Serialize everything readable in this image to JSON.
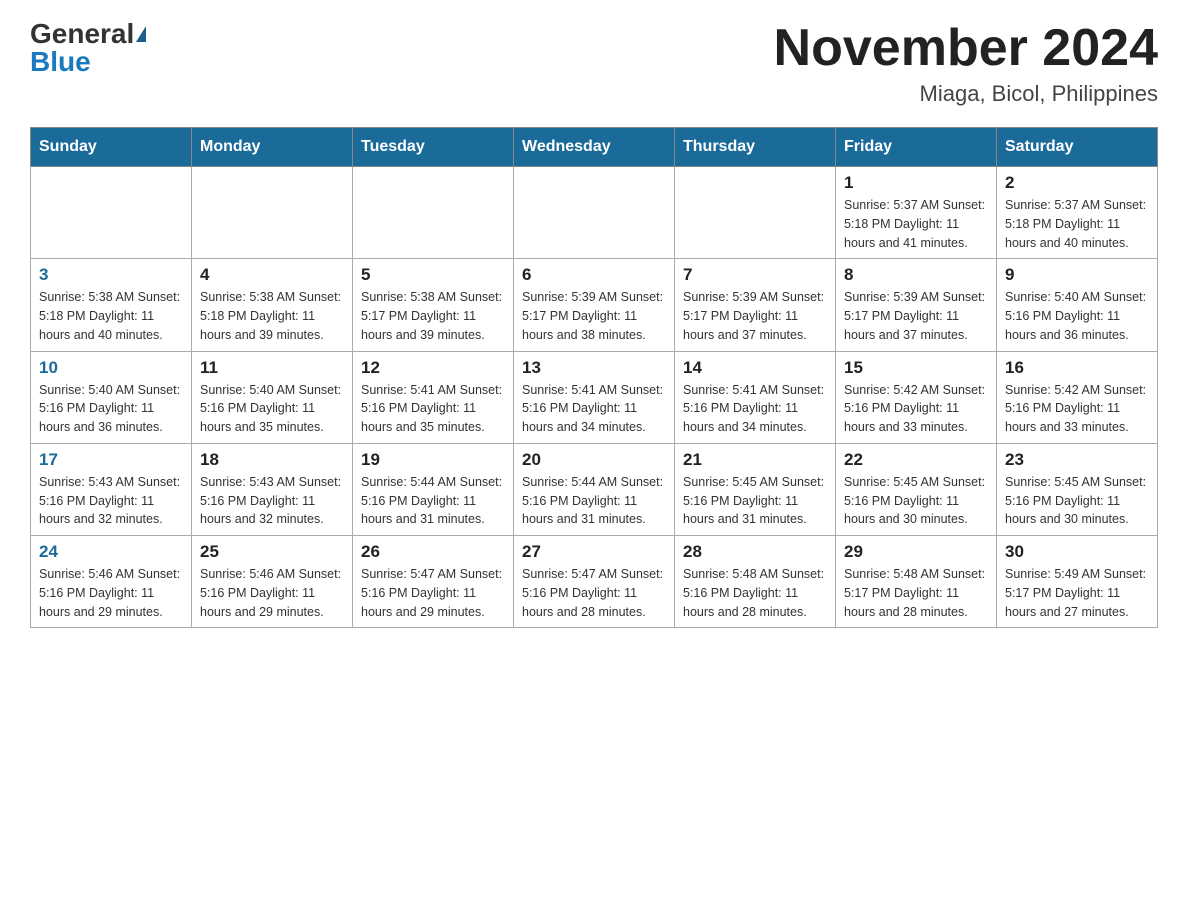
{
  "header": {
    "logo_general": "General",
    "logo_blue": "Blue",
    "month_title": "November 2024",
    "location": "Miaga, Bicol, Philippines"
  },
  "weekdays": [
    "Sunday",
    "Monday",
    "Tuesday",
    "Wednesday",
    "Thursday",
    "Friday",
    "Saturday"
  ],
  "weeks": [
    [
      {
        "day": "",
        "info": ""
      },
      {
        "day": "",
        "info": ""
      },
      {
        "day": "",
        "info": ""
      },
      {
        "day": "",
        "info": ""
      },
      {
        "day": "",
        "info": ""
      },
      {
        "day": "1",
        "info": "Sunrise: 5:37 AM\nSunset: 5:18 PM\nDaylight: 11 hours and 41 minutes."
      },
      {
        "day": "2",
        "info": "Sunrise: 5:37 AM\nSunset: 5:18 PM\nDaylight: 11 hours and 40 minutes."
      }
    ],
    [
      {
        "day": "3",
        "info": "Sunrise: 5:38 AM\nSunset: 5:18 PM\nDaylight: 11 hours and 40 minutes."
      },
      {
        "day": "4",
        "info": "Sunrise: 5:38 AM\nSunset: 5:18 PM\nDaylight: 11 hours and 39 minutes."
      },
      {
        "day": "5",
        "info": "Sunrise: 5:38 AM\nSunset: 5:17 PM\nDaylight: 11 hours and 39 minutes."
      },
      {
        "day": "6",
        "info": "Sunrise: 5:39 AM\nSunset: 5:17 PM\nDaylight: 11 hours and 38 minutes."
      },
      {
        "day": "7",
        "info": "Sunrise: 5:39 AM\nSunset: 5:17 PM\nDaylight: 11 hours and 37 minutes."
      },
      {
        "day": "8",
        "info": "Sunrise: 5:39 AM\nSunset: 5:17 PM\nDaylight: 11 hours and 37 minutes."
      },
      {
        "day": "9",
        "info": "Sunrise: 5:40 AM\nSunset: 5:16 PM\nDaylight: 11 hours and 36 minutes."
      }
    ],
    [
      {
        "day": "10",
        "info": "Sunrise: 5:40 AM\nSunset: 5:16 PM\nDaylight: 11 hours and 36 minutes."
      },
      {
        "day": "11",
        "info": "Sunrise: 5:40 AM\nSunset: 5:16 PM\nDaylight: 11 hours and 35 minutes."
      },
      {
        "day": "12",
        "info": "Sunrise: 5:41 AM\nSunset: 5:16 PM\nDaylight: 11 hours and 35 minutes."
      },
      {
        "day": "13",
        "info": "Sunrise: 5:41 AM\nSunset: 5:16 PM\nDaylight: 11 hours and 34 minutes."
      },
      {
        "day": "14",
        "info": "Sunrise: 5:41 AM\nSunset: 5:16 PM\nDaylight: 11 hours and 34 minutes."
      },
      {
        "day": "15",
        "info": "Sunrise: 5:42 AM\nSunset: 5:16 PM\nDaylight: 11 hours and 33 minutes."
      },
      {
        "day": "16",
        "info": "Sunrise: 5:42 AM\nSunset: 5:16 PM\nDaylight: 11 hours and 33 minutes."
      }
    ],
    [
      {
        "day": "17",
        "info": "Sunrise: 5:43 AM\nSunset: 5:16 PM\nDaylight: 11 hours and 32 minutes."
      },
      {
        "day": "18",
        "info": "Sunrise: 5:43 AM\nSunset: 5:16 PM\nDaylight: 11 hours and 32 minutes."
      },
      {
        "day": "19",
        "info": "Sunrise: 5:44 AM\nSunset: 5:16 PM\nDaylight: 11 hours and 31 minutes."
      },
      {
        "day": "20",
        "info": "Sunrise: 5:44 AM\nSunset: 5:16 PM\nDaylight: 11 hours and 31 minutes."
      },
      {
        "day": "21",
        "info": "Sunrise: 5:45 AM\nSunset: 5:16 PM\nDaylight: 11 hours and 31 minutes."
      },
      {
        "day": "22",
        "info": "Sunrise: 5:45 AM\nSunset: 5:16 PM\nDaylight: 11 hours and 30 minutes."
      },
      {
        "day": "23",
        "info": "Sunrise: 5:45 AM\nSunset: 5:16 PM\nDaylight: 11 hours and 30 minutes."
      }
    ],
    [
      {
        "day": "24",
        "info": "Sunrise: 5:46 AM\nSunset: 5:16 PM\nDaylight: 11 hours and 29 minutes."
      },
      {
        "day": "25",
        "info": "Sunrise: 5:46 AM\nSunset: 5:16 PM\nDaylight: 11 hours and 29 minutes."
      },
      {
        "day": "26",
        "info": "Sunrise: 5:47 AM\nSunset: 5:16 PM\nDaylight: 11 hours and 29 minutes."
      },
      {
        "day": "27",
        "info": "Sunrise: 5:47 AM\nSunset: 5:16 PM\nDaylight: 11 hours and 28 minutes."
      },
      {
        "day": "28",
        "info": "Sunrise: 5:48 AM\nSunset: 5:16 PM\nDaylight: 11 hours and 28 minutes."
      },
      {
        "day": "29",
        "info": "Sunrise: 5:48 AM\nSunset: 5:17 PM\nDaylight: 11 hours and 28 minutes."
      },
      {
        "day": "30",
        "info": "Sunrise: 5:49 AM\nSunset: 5:17 PM\nDaylight: 11 hours and 27 minutes."
      }
    ]
  ]
}
